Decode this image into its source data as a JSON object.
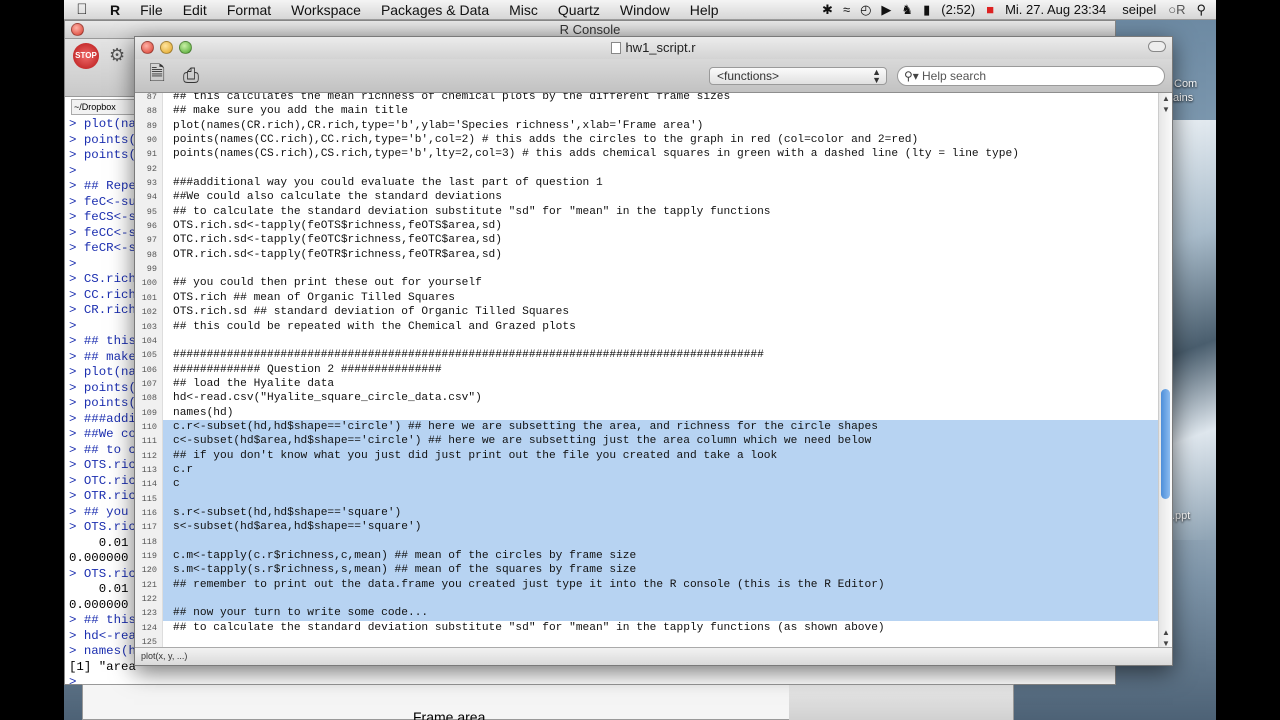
{
  "menubar": {
    "app_name": "R",
    "items": [
      "File",
      "Edit",
      "Format",
      "Workspace",
      "Packages & Data",
      "Misc",
      "Quartz",
      "Window",
      "Help"
    ],
    "battery": "(2:52)",
    "datetime": "Mi. 27. Aug  23:34",
    "user": "seipel",
    "r_status": "R"
  },
  "console": {
    "title": "R Console",
    "stop_label": "STOP",
    "path": "~/Dropbox",
    "lines": [
      {
        "t": "> plot(na",
        "o": false
      },
      {
        "t": "> points(",
        "o": false
      },
      {
        "t": "> points(",
        "o": false
      },
      {
        "t": ">",
        "o": false
      },
      {
        "t": "> ## Repe",
        "o": false
      },
      {
        "t": "> feC<-su",
        "o": false
      },
      {
        "t": "> feCS<-s",
        "o": false
      },
      {
        "t": "> feCC<-s",
        "o": false
      },
      {
        "t": "> feCR<-s",
        "o": false
      },
      {
        "t": ">",
        "o": false
      },
      {
        "t": "> CS.rich",
        "o": false
      },
      {
        "t": "> CC.rich",
        "o": false
      },
      {
        "t": "> CR.rich",
        "o": false
      },
      {
        "t": ">",
        "o": false
      },
      {
        "t": "> ## this",
        "o": false
      },
      {
        "t": "> ## make",
        "o": false
      },
      {
        "t": "> plot(na",
        "o": false
      },
      {
        "t": "> points(",
        "o": false
      },
      {
        "t": "> points(",
        "o": false
      },
      {
        "t": "> ###addi",
        "o": false
      },
      {
        "t": "> ##We co",
        "o": false
      },
      {
        "t": "> ## to c",
        "o": false
      },
      {
        "t": "> OTS.ric",
        "o": false
      },
      {
        "t": "> OTC.ric",
        "o": false
      },
      {
        "t": "> OTR.ric",
        "o": false
      },
      {
        "t": "> ## you",
        "o": false
      },
      {
        "t": "> OTS.ric",
        "o": false
      },
      {
        "t": "    0.01",
        "o": true
      },
      {
        "t": "0.000000",
        "o": true
      },
      {
        "t": "> OTS.ric",
        "o": false
      },
      {
        "t": "    0.01",
        "o": true
      },
      {
        "t": "0.000000",
        "o": true
      },
      {
        "t": "> ## this",
        "o": false
      },
      {
        "t": "> hd<-rea",
        "o": false
      },
      {
        "t": "> names(h",
        "o": false
      },
      {
        "t": "[1] \"area",
        "o": true
      },
      {
        "t": ">",
        "o": false
      }
    ]
  },
  "bottom_window": {
    "label": "Frame area"
  },
  "desktop_labels": {
    "top": "Com",
    "top2": "tains",
    "file": ".ppt"
  },
  "editor": {
    "title": "hw1_script.r",
    "functions_select": "<functions>",
    "search_placeholder": "Help search",
    "status_hint": "plot(x, y, ...)",
    "code": [
      {
        "n": "87",
        "t": "## this calculates the mean richness of chemical plots by the different frame sizes",
        "s": false
      },
      {
        "n": "88",
        "t": "## make sure you add the main title",
        "s": false
      },
      {
        "n": "89",
        "t": "plot(names(CR.rich),CR.rich,type='b',ylab='Species richness',xlab='Frame area')",
        "s": false
      },
      {
        "n": "90",
        "t": "points(names(CC.rich),CC.rich,type='b',col=2) # this adds the circles to the graph in red (col=color and 2=red)",
        "s": false
      },
      {
        "n": "91",
        "t": "points(names(CS.rich),CS.rich,type='b',lty=2,col=3) # this adds chemical squares in green with a dashed line (lty = line type)",
        "s": false
      },
      {
        "n": "92",
        "t": "",
        "s": false
      },
      {
        "n": "93",
        "t": "###additional way you could evaluate the last part of question 1",
        "s": false
      },
      {
        "n": "94",
        "t": "##We could also calculate the standard deviations",
        "s": false
      },
      {
        "n": "95",
        "t": "## to calculate the standard deviation substitute \"sd\" for \"mean\" in the tapply functions",
        "s": false
      },
      {
        "n": "96",
        "t": "OTS.rich.sd<-tapply(feOTS$richness,feOTS$area,sd)",
        "s": false
      },
      {
        "n": "97",
        "t": "OTC.rich.sd<-tapply(feOTC$richness,feOTC$area,sd)",
        "s": false
      },
      {
        "n": "98",
        "t": "OTR.rich.sd<-tapply(feOTR$richness,feOTR$area,sd)",
        "s": false
      },
      {
        "n": "99",
        "t": "",
        "s": false
      },
      {
        "n": "100",
        "t": "## you could then print these out for yourself",
        "s": false
      },
      {
        "n": "101",
        "t": "OTS.rich ## mean of Organic Tilled Squares",
        "s": false
      },
      {
        "n": "102",
        "t": "OTS.rich.sd ## standard deviation of Organic Tilled Squares",
        "s": false
      },
      {
        "n": "103",
        "t": "## this could be repeated with the Chemical and Grazed plots",
        "s": false
      },
      {
        "n": "104",
        "t": "",
        "s": false
      },
      {
        "n": "105",
        "t": "########################################################################################",
        "s": false
      },
      {
        "n": "106",
        "t": "############# Question 2 ###############",
        "s": false
      },
      {
        "n": "107",
        "t": "## load the Hyalite data",
        "s": false
      },
      {
        "n": "108",
        "t": "hd<-read.csv(\"Hyalite_square_circle_data.csv\")",
        "s": false
      },
      {
        "n": "109",
        "t": "names(hd)",
        "s": false
      },
      {
        "n": "110",
        "t": "c.r<-subset(hd,hd$shape=='circle') ## here we are subsetting the area, and richness for the circle shapes",
        "s": true
      },
      {
        "n": "111",
        "t": "c<-subset(hd$area,hd$shape=='circle') ## here we are subsetting just the area column which we need below",
        "s": true
      },
      {
        "n": "112",
        "t": "## if you don't know what you just did just print out the file you created and take a look",
        "s": true
      },
      {
        "n": "113",
        "t": "c.r",
        "s": true
      },
      {
        "n": "114",
        "t": "c",
        "s": true
      },
      {
        "n": "115",
        "t": "",
        "s": true
      },
      {
        "n": "116",
        "t": "s.r<-subset(hd,hd$shape=='square')",
        "s": true
      },
      {
        "n": "117",
        "t": "s<-subset(hd$area,hd$shape=='square')",
        "s": true
      },
      {
        "n": "118",
        "t": "",
        "s": true
      },
      {
        "n": "119",
        "t": "c.m<-tapply(c.r$richness,c,mean) ## mean of the circles by frame size",
        "s": true
      },
      {
        "n": "120",
        "t": "s.m<-tapply(s.r$richness,s,mean) ## mean of the squares by frame size",
        "s": true
      },
      {
        "n": "121",
        "t": "## remember to print out the data.frame you created just type it into the R console (this is the R Editor)",
        "s": true
      },
      {
        "n": "122",
        "t": "",
        "s": true
      },
      {
        "n": "123",
        "t": "## now your turn to write some code...",
        "s": true
      },
      {
        "n": "124",
        "t": "## to calculate the standard deviation substitute \"sd\" for \"mean\" in the tapply functions (as shown above)",
        "s": false
      },
      {
        "n": "125",
        "t": "",
        "s": false
      }
    ]
  }
}
